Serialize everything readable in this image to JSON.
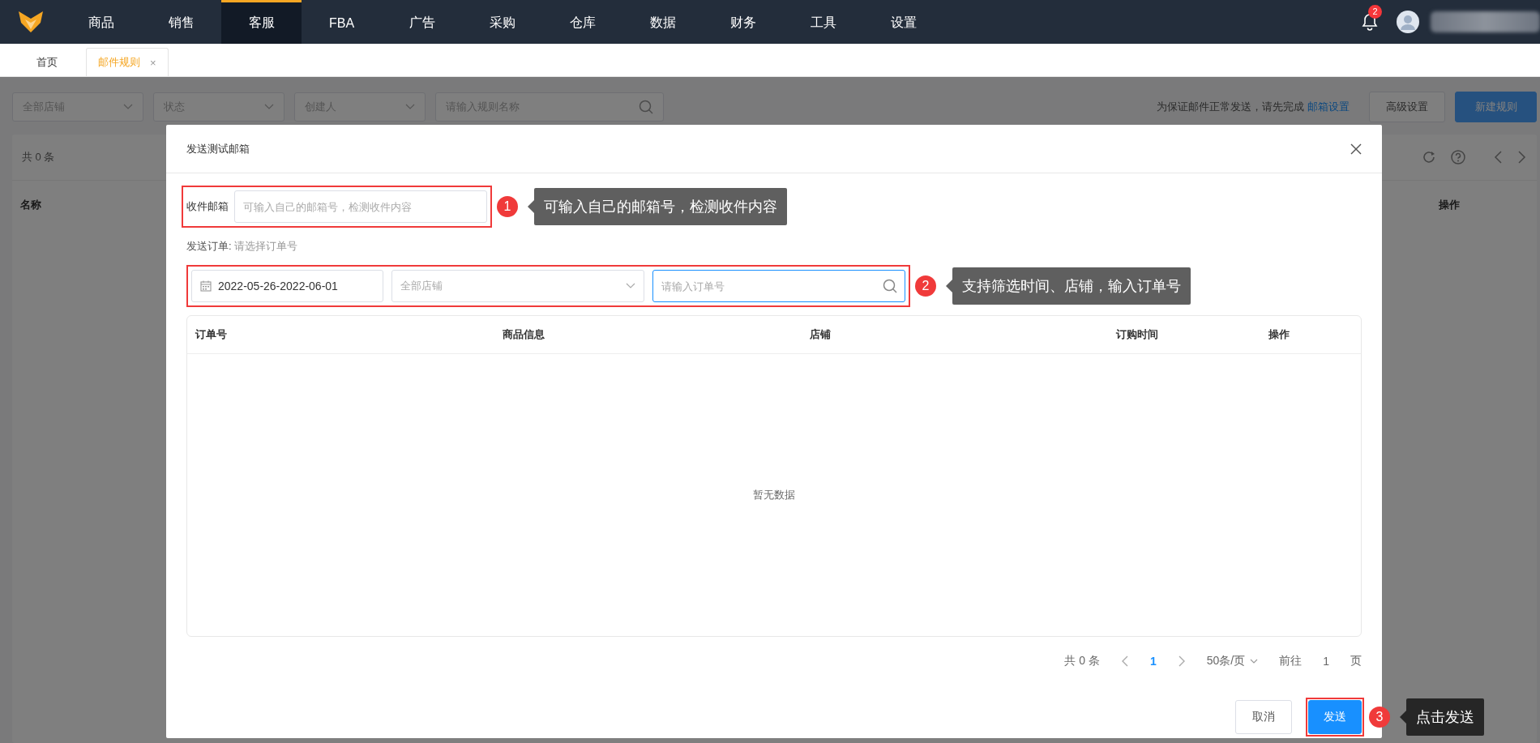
{
  "top_nav": {
    "items": [
      {
        "label": "商品",
        "selected": false
      },
      {
        "label": "销售",
        "selected": false
      },
      {
        "label": "客服",
        "selected": true
      },
      {
        "label": "FBA",
        "selected": false
      },
      {
        "label": "广告",
        "selected": false
      },
      {
        "label": "采购",
        "selected": false
      },
      {
        "label": "仓库",
        "selected": false
      },
      {
        "label": "数据",
        "selected": false
      },
      {
        "label": "财务",
        "selected": false
      },
      {
        "label": "工具",
        "selected": false
      },
      {
        "label": "设置",
        "selected": false
      }
    ],
    "notification_count": "2"
  },
  "page_tabs": [
    {
      "label": "首页",
      "selected": false
    },
    {
      "label": "邮件规则",
      "selected": true,
      "close": "×"
    }
  ],
  "filters": {
    "store": {
      "placeholder": "全部店铺"
    },
    "status": {
      "placeholder": "状态"
    },
    "creator": {
      "placeholder": "创建人"
    },
    "rule_search": {
      "placeholder": "请输入规则名称"
    },
    "notice": "为保证邮件正常发送，请先完成",
    "notice_link": "邮箱设置",
    "buttons": [
      {
        "label": "高级设置",
        "kind": "default"
      },
      {
        "label": "新建规则",
        "kind": "primary"
      }
    ]
  },
  "rules_table": {
    "total": "共 0 条",
    "columns": [
      "名称",
      "操作"
    ]
  },
  "dialog": {
    "title": "发送测试邮箱",
    "recipient": {
      "label": "收件邮箱",
      "placeholder": "可输入自己的邮箱号，检测收件内容"
    },
    "order_label": "发送订单:",
    "order_hint": "请选择订单号",
    "date_range": {
      "value": "2022-05-26-2022-06-01"
    },
    "store": {
      "placeholder": "全部店铺"
    },
    "order_search": {
      "placeholder": "请输入订单号",
      "focused": true
    },
    "table": {
      "columns": [
        "订单号",
        "商品信息",
        "店铺",
        "订购时间",
        "操作"
      ],
      "empty": "暂无数据"
    },
    "pagination": {
      "total": "共 0 条",
      "pages": [
        {
          "label": "1",
          "selected": true
        }
      ],
      "page_size": "50条/页",
      "goto_label": "前往",
      "goto_value": "1",
      "goto_suffix": "页"
    },
    "buttons": [
      {
        "label": "取消",
        "kind": "default"
      },
      {
        "label": "发送",
        "kind": "primary"
      }
    ]
  },
  "annotations": [
    {
      "number": "1",
      "text": "可输入自己的邮箱号，检测收件内容",
      "color": "#5f5f5f"
    },
    {
      "number": "2",
      "text": "支持筛选时间、店铺，输入订单号",
      "color": "#5f5f5f"
    },
    {
      "number": "3",
      "text": "点击发送",
      "color": "#262626"
    }
  ]
}
